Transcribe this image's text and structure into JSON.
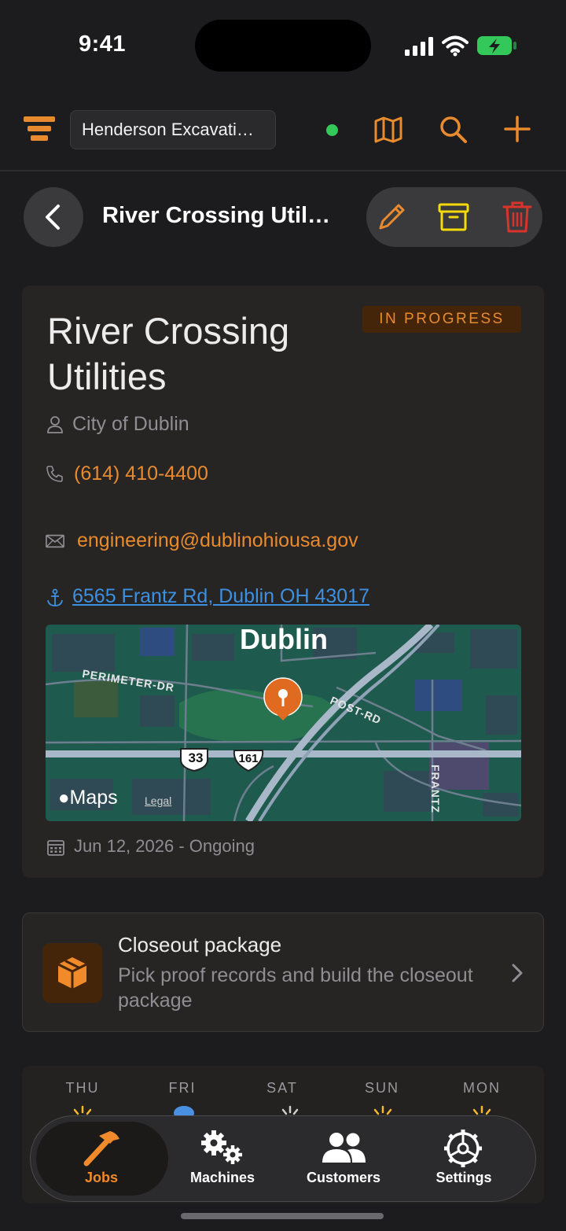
{
  "status_bar": {
    "time": "9:41"
  },
  "header": {
    "organization": "Henderson Excavati…",
    "sync_status_color": "#34c759"
  },
  "subheader": {
    "title": "River Crossing Util…"
  },
  "job": {
    "title": "River Crossing Utilities",
    "status": "IN PROGRESS",
    "customer": "City of Dublin",
    "phone": "(614) 410-4400",
    "email": "engineering@dublinohiousa.gov",
    "address": "6565 Frantz Rd, Dublin OH 43017",
    "date_range": "Jun 12, 2026 - Ongoing"
  },
  "map": {
    "city_label": "Dublin",
    "roads": [
      "PERIMETER-DR",
      "POST-RD",
      "FRANTZ"
    ],
    "shields": [
      "33",
      "161"
    ],
    "brand": "Maps",
    "legal": "Legal"
  },
  "closeout": {
    "title": "Closeout package",
    "subtitle": "Pick proof records and build the closeout package"
  },
  "weather": {
    "days": [
      "THU",
      "FRI",
      "SAT",
      "SUN",
      "MON"
    ]
  },
  "tabs": [
    {
      "label": "Jobs",
      "icon": "hammer-icon",
      "active": true
    },
    {
      "label": "Machines",
      "icon": "gears-icon",
      "active": false
    },
    {
      "label": "Customers",
      "icon": "people-icon",
      "active": false
    },
    {
      "label": "Settings",
      "icon": "gear-icon",
      "active": false
    }
  ],
  "colors": {
    "accent": "#e88a2e",
    "archive": "#f5d90a",
    "delete": "#d9342b",
    "link": "#3d8fe0",
    "background": "#1c1c1e"
  }
}
